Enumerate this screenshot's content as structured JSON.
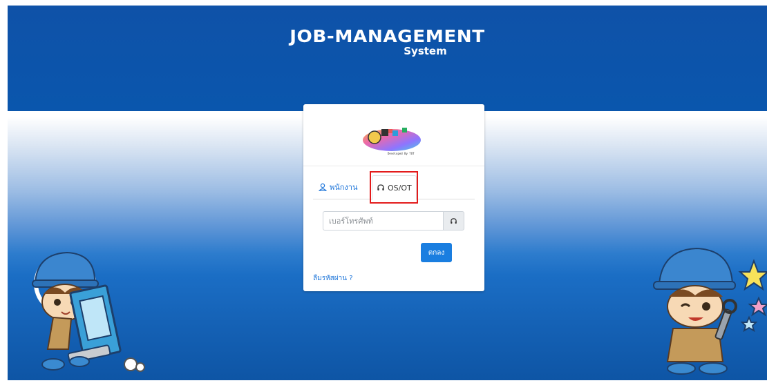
{
  "header": {
    "title": "JOB-MANAGEMENT",
    "subtitle": "System"
  },
  "logo": {
    "text": "JOB-M",
    "caption": "Developed By TOT"
  },
  "tabs": [
    {
      "label": "พนักงาน",
      "icon": "user-icon",
      "active": false
    },
    {
      "label": "OS/OT",
      "icon": "headset-icon",
      "active": true
    }
  ],
  "form": {
    "phone_placeholder": "เบอร์โทรศัพท์",
    "phone_value": "",
    "addon_icon": "headset-icon",
    "submit_label": "ตกลง",
    "forgot_label": "ลืมรหัสผ่าน ?"
  },
  "colors": {
    "brand_blue": "#0a56ad",
    "accent_blue": "#1a7ee0",
    "highlight_red": "#e31b1b"
  }
}
